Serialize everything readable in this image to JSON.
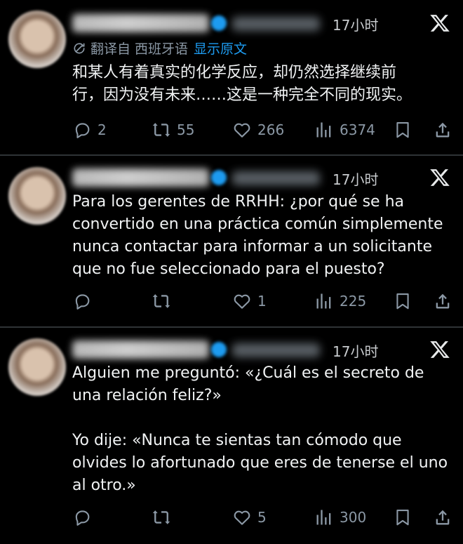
{
  "tweets": [
    {
      "time": "17小时",
      "translated_from": "翻译自 西班牙语",
      "show_original": "显示原文",
      "text": "和某人有着真实的化学反应，却仍然选择继续前\n行，因为没有未来……这是一种完全不同的现实。",
      "replies": "2",
      "reposts": "55",
      "likes": "266",
      "views": "6374"
    },
    {
      "time": "17小时",
      "text": "Para los gerentes de RRHH: ¿por qué se ha\nconvertido en una práctica común simplemente\nnunca contactar para informar a un solicitante\nque no fue seleccionado para el puesto?",
      "replies": "",
      "reposts": "",
      "likes": "1",
      "views": "225"
    },
    {
      "time": "17小时",
      "text": "Alguien me preguntó: «¿Cuál es el secreto de\nuna relación feliz?»\n\nYo dije: «Nunca te sientas tan cómodo que\nolvides lo afortunado que eres de tenerse el uno\nal otro.»",
      "replies": "",
      "reposts": "",
      "likes": "5",
      "views": "300"
    }
  ],
  "icons": {
    "reply": "speech-bubble",
    "repost": "repost-arrows",
    "like": "heart",
    "views": "bar-chart",
    "bookmark": "bookmark",
    "share": "share-upload",
    "more": "x-logo"
  },
  "colors": {
    "background": "#000000",
    "text": "#e7e9ea",
    "muted": "#8b98a5",
    "accent": "#1d9bf0",
    "divider": "#2f3336"
  }
}
